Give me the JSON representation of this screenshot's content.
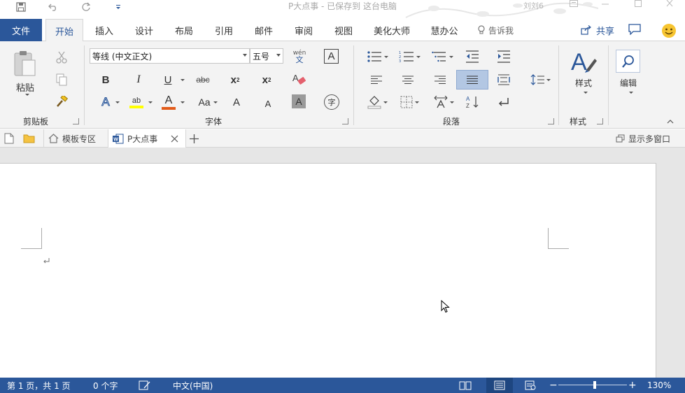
{
  "titlebar": {
    "title": "P大点事 - 已保存到 这台电脑",
    "user": "刘刘6"
  },
  "tabs": {
    "file": "文件",
    "items": [
      "开始",
      "插入",
      "设计",
      "布局",
      "引用",
      "邮件",
      "审阅",
      "视图",
      "美化大师",
      "慧办公"
    ],
    "active": "开始",
    "tell_me": "告诉我",
    "share": "共享"
  },
  "ribbon": {
    "clipboard": {
      "paste_label": "粘贴",
      "group_label": "剪贴板"
    },
    "font": {
      "font_name": "等线 (中文正文)",
      "font_size": "五号",
      "phonetic": "wén",
      "phonetic_char": "文",
      "group_label": "字体",
      "bold": "B",
      "italic": "I",
      "underline": "U",
      "strike": "abc",
      "subscript": "x",
      "superscript": "x",
      "sub_mark": "2",
      "sup_mark": "2",
      "change_case": "Aa",
      "grow": "A",
      "shrink": "A",
      "char_border": "A",
      "char_shading": "A",
      "enclose": "字",
      "highlight": "ab",
      "font_color": "A",
      "text_effect": "A",
      "clear_format": "A"
    },
    "paragraph": {
      "group_label": "段落"
    },
    "styles": {
      "label": "样式",
      "group_label": "样式"
    },
    "editing": {
      "label": "编辑"
    }
  },
  "doc_tabs": {
    "template_zone": "模板专区",
    "doc_name": "P大点事",
    "multi_window": "显示多窗口"
  },
  "status": {
    "page": "第 1 页，共 1 页",
    "words": "0 个字",
    "language": "中文(中国)",
    "zoom": "130%"
  },
  "colors": {
    "accent": "#2b579a",
    "ribbon_bg": "#f3f3f3",
    "highlight_yellow": "#ffff00",
    "font_color_red": "#e25b1a"
  }
}
